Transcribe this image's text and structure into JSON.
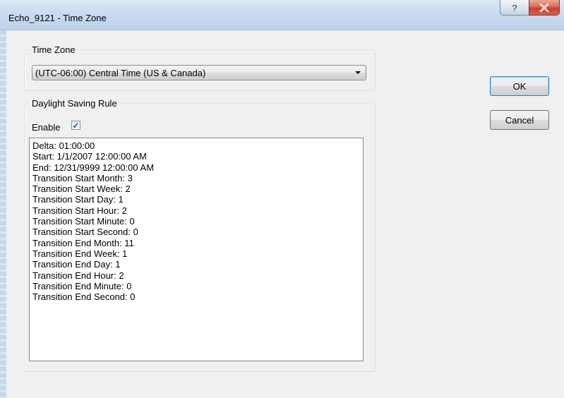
{
  "window": {
    "title": "Echo_9121 - Time Zone",
    "help_glyph": "?",
    "close_glyph": "X"
  },
  "time_zone_group": {
    "label": "Time Zone",
    "selected": "(UTC-06:00) Central Time (US & Canada)"
  },
  "dst_group": {
    "label": "Daylight Saving Rule",
    "enable_label": "Enable",
    "enable_checked": true,
    "check_glyph": "✓",
    "lines": [
      "Delta: 01:00:00",
      "Start: 1/1/2007 12:00:00 AM",
      "End: 12/31/9999 12:00:00 AM",
      "Transition Start Month: 3",
      "Transition Start Week: 2",
      "Transition Start Day: 1",
      "Transition Start Hour: 2",
      "Transition Start Minute: 0",
      "Transition Start Second: 0",
      "Transition End Month: 11",
      "Transition End Week: 1",
      "Transition End Day: 1",
      "Transition End Hour: 2",
      "Transition End Minute: 0",
      "Transition End Second: 0"
    ]
  },
  "buttons": {
    "ok": "OK",
    "cancel": "Cancel"
  },
  "icons": {
    "help": "help-icon",
    "close": "close-icon",
    "dropdown": "chevron-down-icon",
    "check": "checkmark-icon"
  }
}
